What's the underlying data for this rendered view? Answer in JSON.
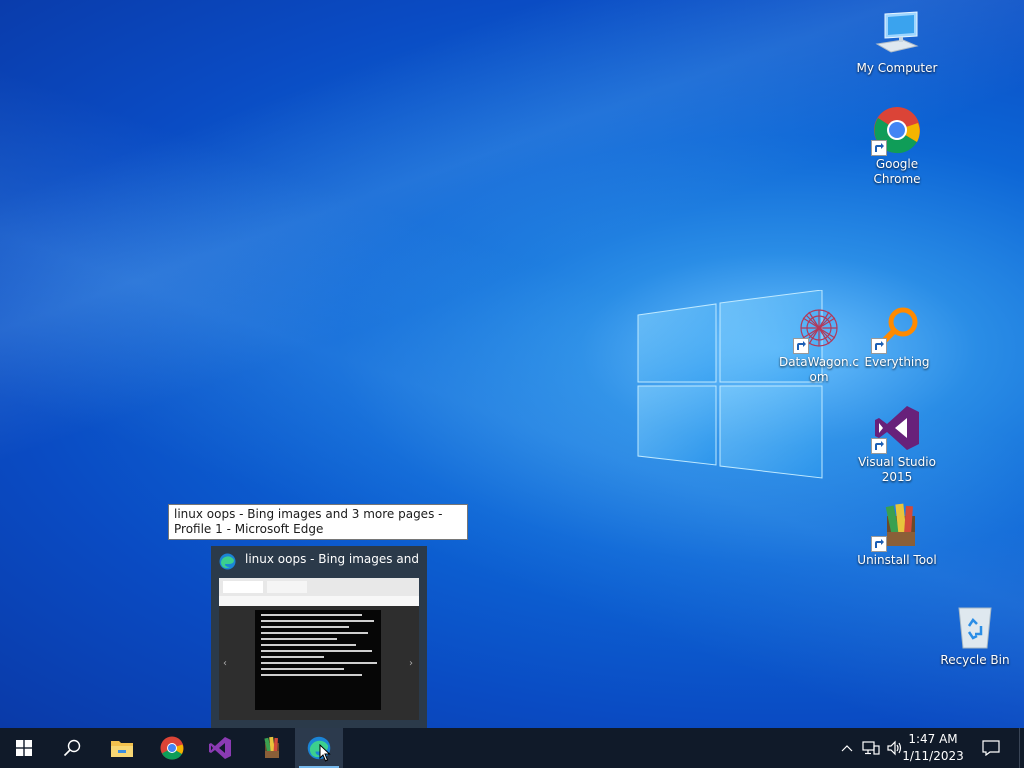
{
  "desktop": {
    "icons": [
      {
        "label": "My Computer"
      },
      {
        "label": "Google Chrome"
      },
      {
        "label": "DataWagon.com"
      },
      {
        "label": "Everything"
      },
      {
        "label": "Visual Studio 2015"
      },
      {
        "label": "Uninstall Tool"
      },
      {
        "label": "Recycle Bin"
      }
    ]
  },
  "tooltip": {
    "text": "linux oops - Bing images and 3 more pages - Profile 1 - Microsoft Edge"
  },
  "preview": {
    "title": "linux oops - Bing images and 3 ..."
  },
  "taskbar": {
    "apps": [
      "start-icon",
      "search-icon",
      "file-explorer-icon",
      "chrome-icon",
      "visual-studio-icon",
      "uninstall-tool-icon",
      "edge-icon"
    ],
    "clock": {
      "time": "1:47 AM",
      "date": "1/11/2023"
    }
  },
  "colors": {
    "taskbar": "#101a29",
    "accent": "#76b9ed"
  }
}
